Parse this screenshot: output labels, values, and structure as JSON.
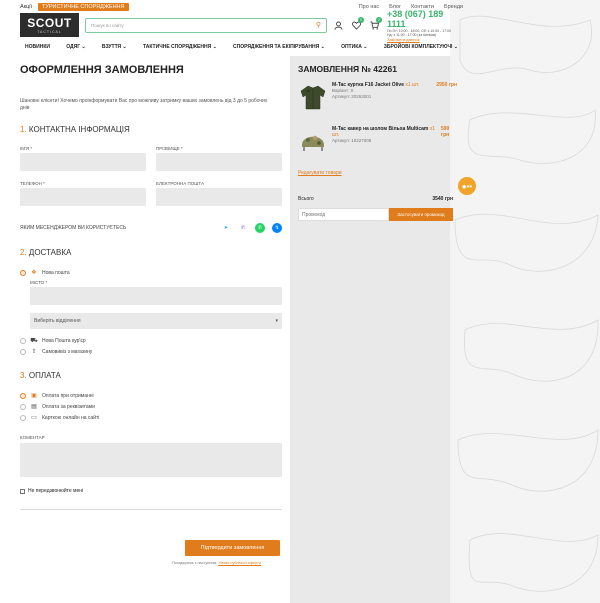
{
  "topbar": {
    "links": [
      "Акції",
      "ТУРИСТИЧНЕ СПОРЯДЖЕННЯ"
    ],
    "right": [
      "Про нас",
      "Блог",
      "Контакти",
      "Бренди"
    ]
  },
  "header": {
    "logo_text": "SCOUT",
    "logo_sub": "TACTICAL",
    "search_placeholder": "Пошук по сайту",
    "wishlist_count": "0",
    "cart_count": "2",
    "phone": "+38 (067) 189 1111",
    "hours1": "Пн-Пт: 10:00 - 18:00, Сб: з 10:00 - 17:00",
    "hours2": "Нд: з 11:00 - 17:00 (за Києвом)",
    "callback": "Замовити дзвінок"
  },
  "nav": [
    "НОВИНКИ",
    "ОДЯГ",
    "ВЗУТТЯ",
    "ТАКТИЧНЕ СПОРЯДЖЕННЯ",
    "СПОРЯДЖЕННЯ ТА ЕКІПІРУВАННЯ",
    "ОПТИКА",
    "ЗБРОЙОВІ КОМПЛЕКТУЮЧІ"
  ],
  "checkout": {
    "title": "ОФОРМЛЕННЯ ЗАМОВЛЕННЯ",
    "notice": "Шановні клієнти! Хочемо проінформувати Вас про можливу затримку ваших замовлень від 3 до 5 робочих днів",
    "contact_num": "1.",
    "contact_title": "КОНТАКТНА ІНФОРМАЦІЯ",
    "name_label": "ІМ'Я *",
    "surname_label": "ПРІЗВИЩЕ *",
    "phone_label": "ТЕЛЕФОН *",
    "email_label": "ЕЛЕКТРОННА ПОШТА",
    "messenger_label": "ЯКИМ МЕСЕНДЖЕРОМ ВИ КОРИСТУЄТЕСЬ",
    "delivery_num": "2.",
    "delivery_title": "ДОСТАВКА",
    "np_label": "Нова пошта",
    "city_label": "МІСТО *",
    "branch_select": "Виберіть відділення",
    "courier_label": "Нова Пошта кур'єр",
    "pickup_label": "Самовивіз з магазину",
    "payment_num": "3.",
    "payment_title": "ОПЛАТА",
    "pay_cod": "Оплата при отриманні",
    "pay_invoice": "Оплата за реквізитами",
    "pay_card": "Карткою онлайн на сайті",
    "comment_label": "КОМЕНТАР",
    "no_call": "Не передзвонюйте мені",
    "confirm": "Підтвердити замовлення",
    "terms_prefix": "Погоджуюсь з наступним:",
    "terms_link": "Умови публічної оферти"
  },
  "order": {
    "title": "ЗАМОВЛЕННЯ № 42261",
    "items": [
      {
        "name": "M-Tac куртка F16 Jacket Olive",
        "qty": "x1 шт.",
        "price": "2950 грн",
        "variant": "Варіант: S",
        "sku": "Артикул: 20263001"
      },
      {
        "name": "M-Tac кавер на шолом Вільха Multicam",
        "qty": "x1 шт.",
        "price": "590 грн",
        "variant": "",
        "sku": "Артикул: 10227008"
      }
    ],
    "edit": "Редагувати товари",
    "total_label": "Всього",
    "total_value": "3540 грн",
    "promo_placeholder": "Промокод",
    "promo_button": "Застосувати промокод"
  },
  "colors": {
    "accent": "#e07c1b",
    "green": "#3bb46e"
  }
}
